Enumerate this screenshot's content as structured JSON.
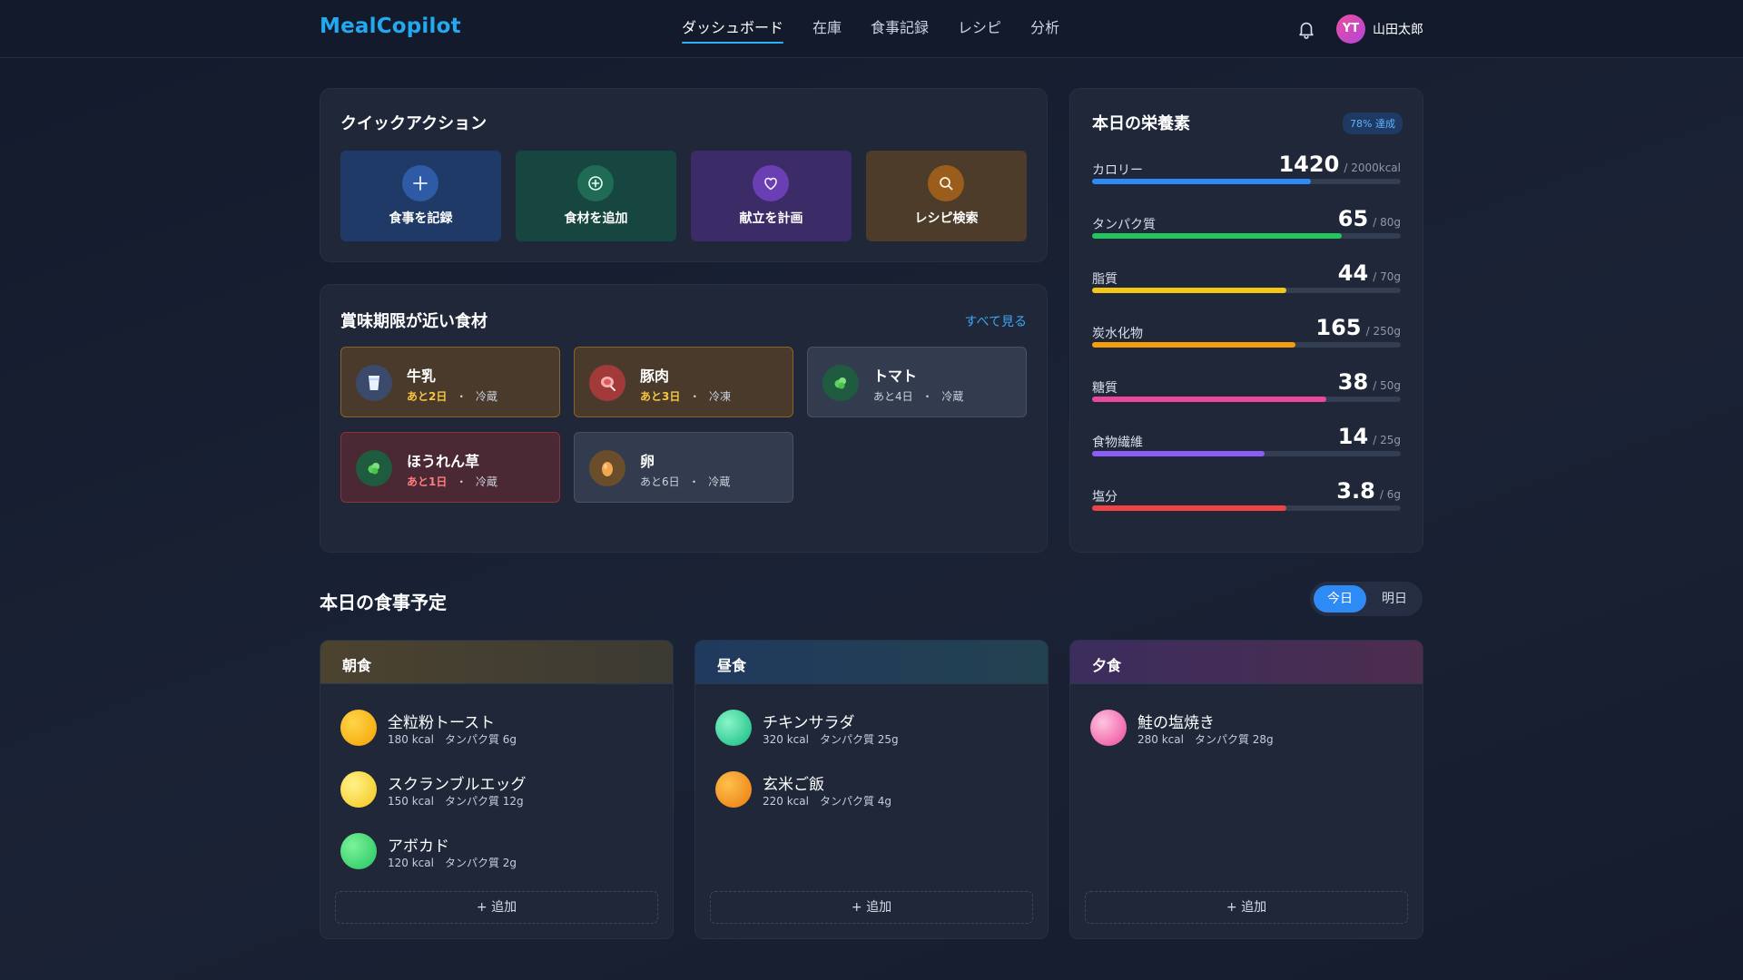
{
  "app": {
    "title": "MealCopilot"
  },
  "nav": {
    "items": [
      {
        "label": "ダッシュボード"
      },
      {
        "label": "在庫"
      },
      {
        "label": "食事記録"
      },
      {
        "label": "レシピ"
      },
      {
        "label": "分析"
      }
    ],
    "active": "ダッシュボード"
  },
  "user": {
    "initials": "YT",
    "name": "山田太郎"
  },
  "quick_actions": {
    "title": "クイックアクション",
    "items": [
      {
        "label": "食事を記録",
        "icon": "plus-icon"
      },
      {
        "label": "食材を追加",
        "icon": "plus-circle-icon"
      },
      {
        "label": "献立を計画",
        "icon": "heart-icon"
      },
      {
        "label": "レシピ検索",
        "icon": "search-icon"
      }
    ]
  },
  "expiring": {
    "title": "賞味期限が近い食材",
    "see_all": "すべて見る",
    "items": [
      {
        "name": "牛乳",
        "days": "あと2日",
        "sep": "・",
        "storage": "冷蔵",
        "icon": "milk-glass-icon"
      },
      {
        "name": "豚肉",
        "days": "あと3日",
        "sep": "・",
        "storage": "冷凍",
        "icon": "meat-icon"
      },
      {
        "name": "トマト",
        "days": "あと4日",
        "sep": "・",
        "storage": "冷蔵",
        "icon": "vegetable-icon"
      },
      {
        "name": "ほうれん草",
        "days": "あと1日",
        "sep": "・",
        "storage": "冷蔵",
        "icon": "leafy-green-icon"
      },
      {
        "name": "卵",
        "days": "あと6日",
        "sep": "・",
        "storage": "冷蔵",
        "icon": "egg-icon"
      }
    ]
  },
  "nutrition": {
    "title": "本日の栄養素",
    "badge": "78% 達成",
    "items": [
      {
        "label": "カロリー",
        "value": "1420",
        "goal": "/ 2000kcal",
        "ratio": 0.71,
        "color": "#2e8af5"
      },
      {
        "label": "タンパク質",
        "value": "65",
        "goal": "/ 80g",
        "ratio": 0.81,
        "color": "#22c55e"
      },
      {
        "label": "脂質",
        "value": "44",
        "goal": "/ 70g",
        "ratio": 0.63,
        "color": "#f5c518"
      },
      {
        "label": "炭水化物",
        "value": "165",
        "goal": "/ 250g",
        "ratio": 0.66,
        "color": "#f59e0b"
      },
      {
        "label": "糖質",
        "value": "38",
        "goal": "/ 50g",
        "ratio": 0.76,
        "color": "#ec4899"
      },
      {
        "label": "食物繊維",
        "value": "14",
        "goal": "/ 25g",
        "ratio": 0.56,
        "color": "#8b5cf6"
      },
      {
        "label": "塩分",
        "value": "3.8",
        "goal": "/ 6g",
        "ratio": 0.63,
        "color": "#ef4444"
      }
    ]
  },
  "meal_plan": {
    "title": "本日の食事予定",
    "toggle": {
      "today": "今日",
      "tomorrow": "明日"
    },
    "add_label": "+ 追加",
    "meals": [
      {
        "name": "朝食",
        "dishes": [
          {
            "name": "全粒粉トースト",
            "meta": "180 kcal　タンパク質 6g"
          },
          {
            "name": "スクランブルエッグ",
            "meta": "150 kcal　タンパク質 12g"
          },
          {
            "name": "アボカド",
            "meta": "120 kcal　タンパク質 2g"
          }
        ]
      },
      {
        "name": "昼食",
        "dishes": [
          {
            "name": "チキンサラダ",
            "meta": "320 kcal　タンパク質 25g"
          },
          {
            "name": "玄米ご飯",
            "meta": "220 kcal　タンパク質 4g"
          }
        ]
      },
      {
        "name": "夕食",
        "dishes": [
          {
            "name": "鮭の塩焼き",
            "meta": "280 kcal　タンパク質 28g"
          }
        ]
      }
    ]
  }
}
